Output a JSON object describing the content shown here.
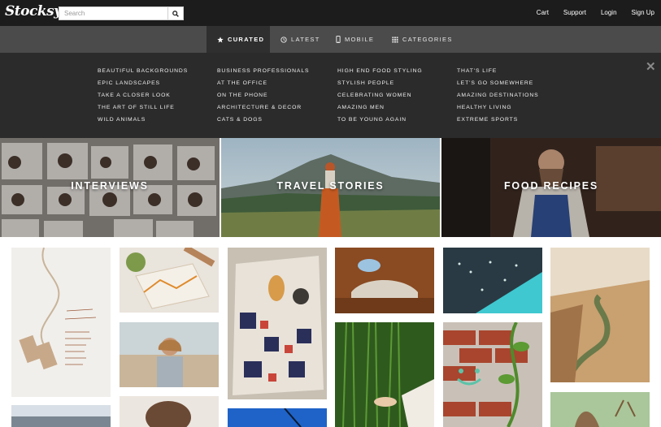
{
  "header": {
    "logo": "Stocksy",
    "search_placeholder": "Search",
    "links": [
      "Cart",
      "Support",
      "Login",
      "Sign Up"
    ]
  },
  "nav": {
    "items": [
      {
        "label": "CURATED",
        "icon": "star-icon",
        "active": true
      },
      {
        "label": "LATEST",
        "icon": "clock-icon",
        "active": false
      },
      {
        "label": "MOBILE",
        "icon": "mobile-icon",
        "active": false
      },
      {
        "label": "CATEGORIES",
        "icon": "grid-icon",
        "active": false
      }
    ]
  },
  "mega_menu": {
    "columns": [
      [
        "BEAUTIFUL BACKGROUNDS",
        "EPIC LANDSCAPES",
        "TAKE A CLOSER LOOK",
        "THE ART OF STILL LIFE",
        "WILD ANIMALS"
      ],
      [
        "BUSINESS PROFESSIONALS",
        "AT THE OFFICE",
        "ON THE PHONE",
        "ARCHITECTURE & DECOR",
        "CATS & DOGS"
      ],
      [
        "HIGH END FOOD STYLING",
        "STYLISH PEOPLE",
        "CELEBRATING WOMEN",
        "AMAZING MEN",
        "TO BE YOUNG AGAIN"
      ],
      [
        "THAT'S LIFE",
        "LET'S GO SOMEWHERE",
        "AMAZING DESTINATIONS",
        "HEALTHY LIVING",
        "EXTREME SPORTS"
      ]
    ],
    "close_icon": "close-icon"
  },
  "heroes": [
    {
      "title": "INTERVIEWS"
    },
    {
      "title": "TRAVEL STORIES"
    },
    {
      "title": "FOOD RECIPES"
    }
  ],
  "colors": {
    "topbar": "#1c1c1c",
    "nav": "#4b4b4b",
    "nav_active": "#2f2f2f",
    "mega_menu": "#2b2b2b"
  }
}
